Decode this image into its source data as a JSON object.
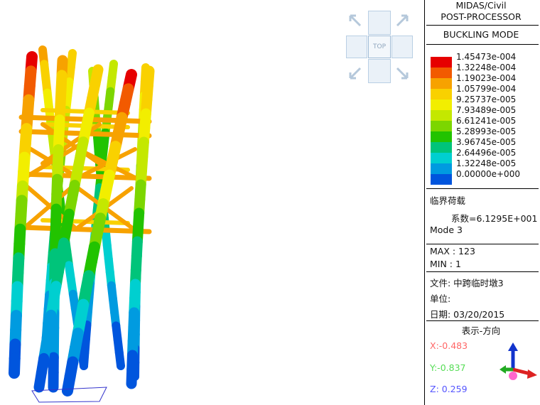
{
  "window": {
    "program": "MIDAS/Civil",
    "module": "POST-PROCESSOR",
    "result_type": "BUCKLING MODE"
  },
  "view_cube": {
    "center_label": "TOP"
  },
  "legend": {
    "levels": [
      {
        "value": "1.45473e-004",
        "color": "#e60000"
      },
      {
        "value": "1.32248e-004",
        "color": "#f25a00"
      },
      {
        "value": "1.19023e-004",
        "color": "#f7a200"
      },
      {
        "value": "1.05799e-004",
        "color": "#f9d100"
      },
      {
        "value": "9.25737e-005",
        "color": "#f2ee00"
      },
      {
        "value": "7.93489e-005",
        "color": "#c4e800"
      },
      {
        "value": "6.61241e-005",
        "color": "#7cd600"
      },
      {
        "value": "5.28993e-005",
        "color": "#22c300"
      },
      {
        "value": "3.96745e-005",
        "color": "#00c47a"
      },
      {
        "value": "2.64496e-005",
        "color": "#00cfd0"
      },
      {
        "value": "1.32248e-005",
        "color": "#009be0"
      },
      {
        "value": "0.00000e+000",
        "color": "#0055dd"
      }
    ]
  },
  "info": {
    "critical_load_label": "临界荷载",
    "coefficient_label": "系数",
    "coefficient_value": "=6.1295E+001",
    "mode": "Mode 3",
    "max": "MAX : 123",
    "min": "MIN : 1",
    "file": "文件: 中跨临时墩3",
    "unit": "单位:",
    "date": "日期: 03/20/2015",
    "view_direction": "表示-方向"
  },
  "direction": {
    "x": {
      "text": "X:-0.483",
      "color": "#ff6666"
    },
    "y": {
      "text": "Y:-0.837",
      "color": "#55dd55"
    },
    "z": {
      "text": "Z:  0.259",
      "color": "#5555ff"
    }
  },
  "model": {
    "description_icon": "buckling-mode-contour",
    "column_count": 10
  }
}
